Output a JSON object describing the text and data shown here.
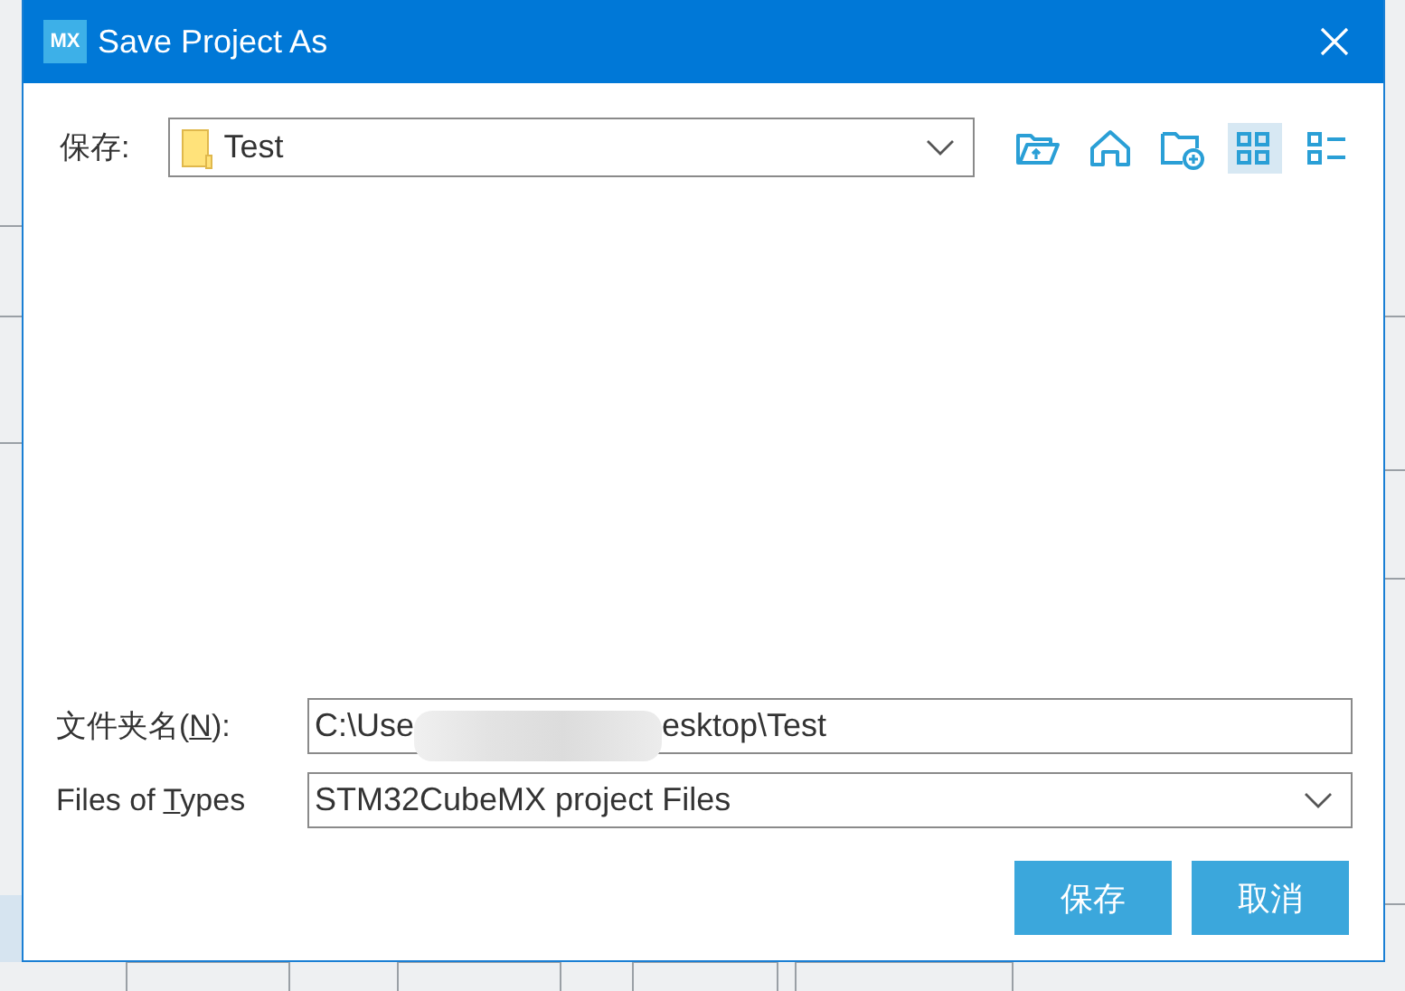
{
  "window": {
    "title": "Save Project As",
    "app_badge": "MX"
  },
  "save_in": {
    "label": "保存:",
    "folder": "Test"
  },
  "toolbar": [
    {
      "kind": "up"
    },
    {
      "kind": "home"
    },
    {
      "kind": "new-folder"
    },
    {
      "kind": "icons",
      "selected": true
    },
    {
      "kind": "list",
      "selected": false
    }
  ],
  "file_name": {
    "label_before": "文件夹名(",
    "mnemonic": "N",
    "label_after": "):",
    "value_before": "C:\\Use",
    "value_after": "esktop\\Test"
  },
  "file_type": {
    "label_before": "Files of ",
    "mnemonic": "T",
    "label_after": "ypes",
    "value": "STM32CubeMX project Files"
  },
  "buttons": [
    "保存",
    "取消"
  ]
}
